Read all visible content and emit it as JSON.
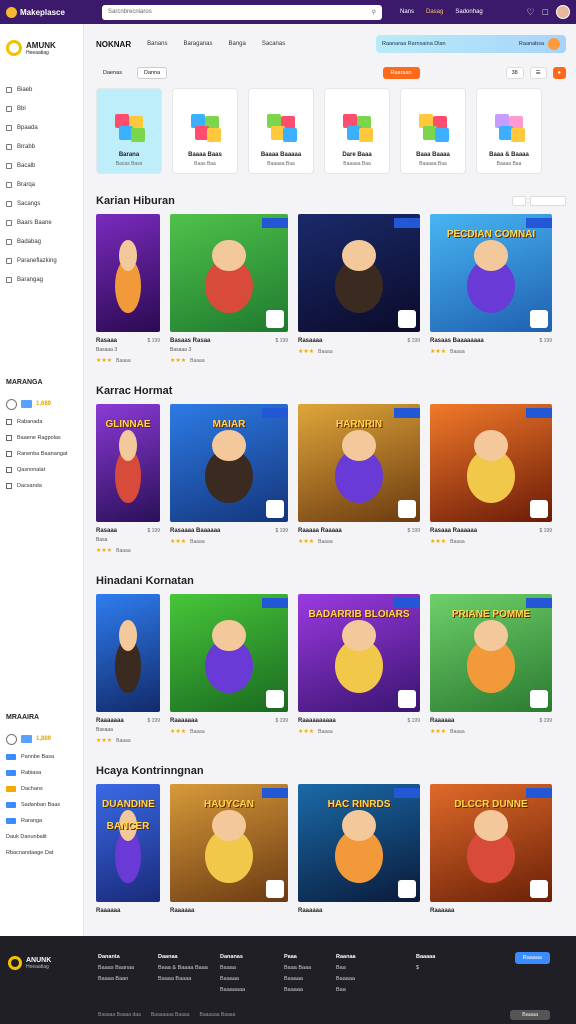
{
  "topbar": {
    "brand": "Makeplasce",
    "search_placeholder": "Sarcnbrecniaros",
    "links": [
      "Nans",
      "Dasag",
      "Sadonhag"
    ],
    "icons": [
      "gift-icon",
      "bell-icon",
      "avatar"
    ]
  },
  "sidebar": {
    "logo": "AMUNK",
    "logo_sub": "Heeaatiag",
    "items": [
      "Biaeb",
      "Bbl",
      "Bpaada",
      "Brrabb",
      "Bacalb",
      "Brarqa",
      "Sacangs",
      "Baars Baane",
      "Badabag",
      "Paraneflazking",
      "Barangag"
    ],
    "section1_title": "MARANGA",
    "section1_value": "1,689",
    "section1_items": [
      "Rabanada",
      "Baaene Ragpolas",
      "Ranenba Baanangat",
      "Qasnonalat",
      "Dacsanda"
    ],
    "section2_title": "MRAAIRA",
    "section2_value": "1,889",
    "section2_items": [
      "Pannbe Basa",
      "Rabiasa",
      "Dachans",
      "Sadanban Baas",
      "Raranga"
    ],
    "section2_foot": [
      "Dauk Danunbalit",
      "Rbacnandaage Dat"
    ]
  },
  "nav": {
    "tabs": [
      "NOKNAR",
      "Banans",
      "Baraganas",
      "Banga",
      "Sacanas"
    ],
    "promo_text": "Raanaraa Rarnsaina Dlan",
    "promo_right": "Raanabsa"
  },
  "filters": {
    "left": [
      "Daenas",
      "Danna"
    ],
    "right_btn": "Raaraan",
    "right_count": "38"
  },
  "categories": [
    {
      "label": "Barana",
      "count": "Bacas Bass",
      "selected": true
    },
    {
      "label": "Baaaa Baas",
      "count": "Baas Baa"
    },
    {
      "label": "Baaaa Baaaaa",
      "count": "Baaaaa Baa"
    },
    {
      "label": "Dare Baaa",
      "count": "Baaaaa Baa"
    },
    {
      "label": "Baaa Baaaa",
      "count": "Baaaaa Baa"
    },
    {
      "label": "Baaa & Baaaa",
      "count": "Baaaa Baa"
    }
  ],
  "sections": [
    {
      "title": "Karian Hiburan",
      "cards": [
        {
          "title": "Rasaaa",
          "sub": "Basaaa 3",
          "price": "$ 199",
          "reviews": "Baaaa",
          "banner": ""
        },
        {
          "title": "Basaas Rasaa",
          "sub": "Basaaa 3",
          "price": "$ 199",
          "reviews": "Baaaa",
          "banner": ""
        },
        {
          "title": "Rasaaaa",
          "sub": "",
          "price": "$ 199",
          "reviews": "Baaaa",
          "banner": ""
        },
        {
          "title": "Rasaas Baaaaaaaa",
          "sub": "",
          "price": "$ 199",
          "reviews": "Baaaa",
          "banner": "PECDIAN COMNAI"
        }
      ]
    },
    {
      "title": "Karrac Hormat",
      "cards": [
        {
          "title": "Rasaaa",
          "sub": "Basa",
          "price": "$ 199",
          "reviews": "Baaaa",
          "banner": "GLINNAE"
        },
        {
          "title": "Rasaaaa Baaaaaa",
          "sub": "",
          "price": "$ 199",
          "reviews": "Baaaa",
          "banner": "MAIAR"
        },
        {
          "title": "Raaaaa Raaaaa",
          "sub": "",
          "price": "$ 199",
          "reviews": "Baaaa",
          "banner": "HARNRIN"
        },
        {
          "title": "Rasaaa Raaaaaa",
          "sub": "",
          "price": "$ 199",
          "reviews": "Baaaa",
          "banner": ""
        }
      ]
    },
    {
      "title": "Hinadani Kornatan",
      "cards": [
        {
          "title": "Raaaaaaa",
          "sub": "Basaaa",
          "price": "$ 199",
          "reviews": "Baaaa",
          "banner": ""
        },
        {
          "title": "Raaaaaaa",
          "sub": "",
          "price": "$ 199",
          "reviews": "Baaaa",
          "banner": ""
        },
        {
          "title": "Raaaaaaaaaa",
          "sub": "",
          "price": "$ 199",
          "reviews": "Baaaa",
          "banner": "BADARRIB BLOIARS"
        },
        {
          "title": "Raaaaaa",
          "sub": "",
          "price": "$ 199",
          "reviews": "Baaaa",
          "banner": "PRIANE POMME"
        }
      ]
    },
    {
      "title": "Hcaya Kontrinngnan",
      "cards": [
        {
          "title": "Raaaaaa",
          "sub": "",
          "price": "",
          "reviews": "",
          "banner": "DUANDINE BANCER"
        },
        {
          "title": "Raaaaaa",
          "sub": "",
          "price": "",
          "reviews": "",
          "banner": "HAUYCAN"
        },
        {
          "title": "Raaaaaa",
          "sub": "",
          "price": "",
          "reviews": "",
          "banner": "HAC RINRDS"
        },
        {
          "title": "Raaaaaa",
          "sub": "",
          "price": "",
          "reviews": "",
          "banner": "DLCCR DUNNE"
        }
      ]
    }
  ],
  "footer": {
    "logo": "ANUNK",
    "logo_sub": "Heeaatiag",
    "cols": [
      {
        "head": "Dananta",
        "items": [
          "Baaas Baanaa",
          "Baaaa Baan"
        ]
      },
      {
        "head": "Daanaa",
        "items": [
          "Baaa & Baaaa Baaa",
          "Baaaa Baaaa"
        ]
      },
      {
        "head": "Dananas",
        "items": [
          "Baaaa",
          "Baaaaa",
          "Baaaaaaa"
        ]
      },
      {
        "head": "Paaa",
        "items": [
          "Baaa Baaa",
          "Baaaaa",
          "Baaaaa"
        ]
      },
      {
        "head": "Raanaa",
        "items": [
          "Baa",
          "Baaaaa",
          "Baa"
        ]
      },
      {
        "head": "Baaaaa",
        "items": [
          "",
          "$"
        ]
      }
    ],
    "cta": "Raaaaa",
    "bottom_links": [
      "Baaaaa Baaaa daa",
      "Baaaaaaa Baaaa",
      "Baaaaaa Baaaa"
    ],
    "lang": "Baaaa"
  }
}
